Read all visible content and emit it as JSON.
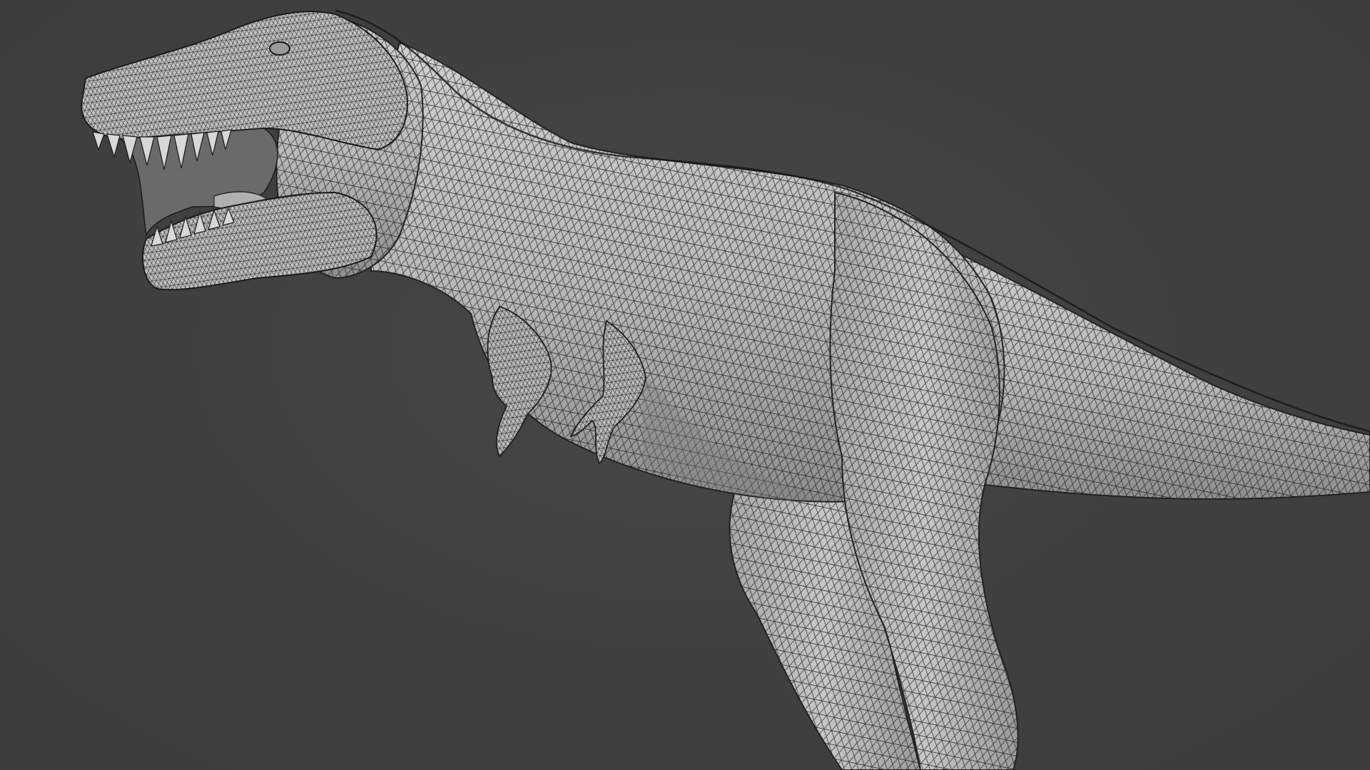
{
  "viewport": {
    "background_color": "#404040",
    "mesh_fill_color": "#b9b9b9",
    "wire_color": "#1e1e1e",
    "subject": "dinosaur-wireframe-model"
  }
}
